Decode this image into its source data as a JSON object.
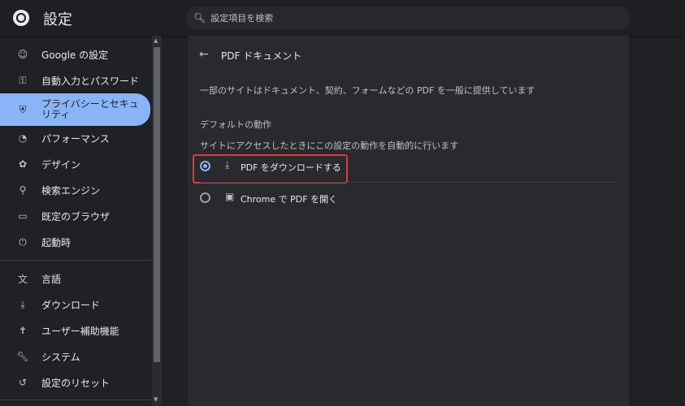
{
  "header": {
    "title": "設定",
    "search_placeholder": "設定項目を検索"
  },
  "sidebar": {
    "items": [
      {
        "label": "Google の設定",
        "icon": "person-icon"
      },
      {
        "label": "自動入力とパスワード",
        "icon": "key-icon"
      },
      {
        "label": "プライバシーとセキュリティ",
        "icon": "shield-icon",
        "selected": true
      },
      {
        "label": "パフォーマンス",
        "icon": "speedometer-icon"
      },
      {
        "label": "デザイン",
        "icon": "palette-icon"
      },
      {
        "label": "検索エンジン",
        "icon": "search-icon"
      },
      {
        "label": "既定のブラウザ",
        "icon": "browser-icon"
      },
      {
        "label": "起動時",
        "icon": "power-icon"
      },
      {
        "label": "言語",
        "icon": "translate-icon"
      },
      {
        "label": "ダウンロード",
        "icon": "download-icon"
      },
      {
        "label": "ユーザー補助機能",
        "icon": "accessibility-icon"
      },
      {
        "label": "システム",
        "icon": "wrench-icon"
      },
      {
        "label": "設定のリセット",
        "icon": "reset-icon"
      }
    ]
  },
  "page": {
    "title": "PDF ドキュメント",
    "description": "一部のサイトはドキュメント、契約、フォームなどの PDF を一般に提供しています",
    "section_title": "デフォルトの動作",
    "section_subtitle": "サイトにアクセスしたときにこの設定の動作を自動的に行います",
    "options": [
      {
        "label": "PDF をダウンロードする",
        "selected": true
      },
      {
        "label": "Chrome で PDF を開く",
        "selected": false
      }
    ]
  }
}
